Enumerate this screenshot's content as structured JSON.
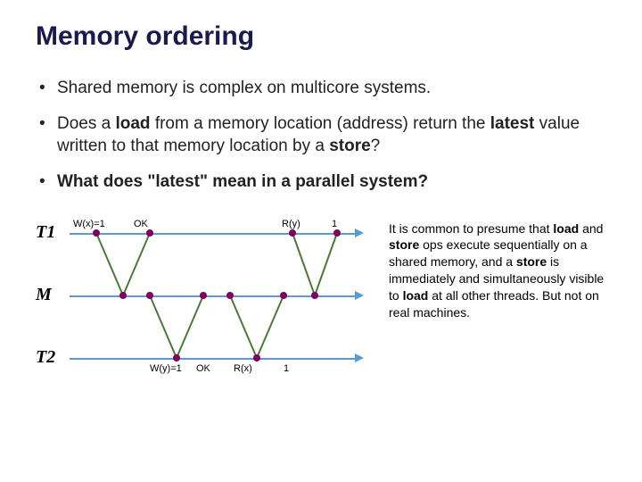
{
  "title": "Memory ordering",
  "bullets": {
    "b1": "Shared memory is complex on multicore systems.",
    "b2_html": "Does a <b>load</b> from a memory location (address) return the <b>latest</b> value written to that memory location by a <b>store</b>?",
    "b3_html": "<b>What does \"latest\" mean in a parallel system?</b>"
  },
  "diagram": {
    "rows": {
      "t1": "T1",
      "m": "M",
      "t2": "T2"
    },
    "labels": {
      "wx": "W(x)=1",
      "ok1": "OK",
      "ry": "R(y)",
      "one_top": "1",
      "wy": "W(y)=1",
      "ok2": "OK",
      "rx": "R(x)",
      "one_bot": "1"
    }
  },
  "sidenote_html": "It is common to presume that <b>load</b> and <b>store</b> ops execute sequentially on a shared memory, and a <b>store</b> is immediately and simultaneously visible to <b>load</b> at all other threads. But not on real machines.",
  "chart_data": {
    "type": "diagram",
    "description": "Sequence/timeline diagram with three horizontal timelines T1, M, T2. Green zig-zag arrows carry events between threads via shared memory M.",
    "timelines": [
      "T1",
      "M",
      "T2"
    ],
    "events": [
      {
        "from": "T1",
        "label": "W(x)=1",
        "to": "M",
        "ack": "OK"
      },
      {
        "from": "T2",
        "label": "W(y)=1",
        "to": "M",
        "ack": "OK"
      },
      {
        "from": "T2",
        "label": "R(x)",
        "to": "M",
        "result": "1"
      },
      {
        "from": "T1",
        "label": "R(y)",
        "to": "M",
        "result": "1"
      }
    ]
  }
}
